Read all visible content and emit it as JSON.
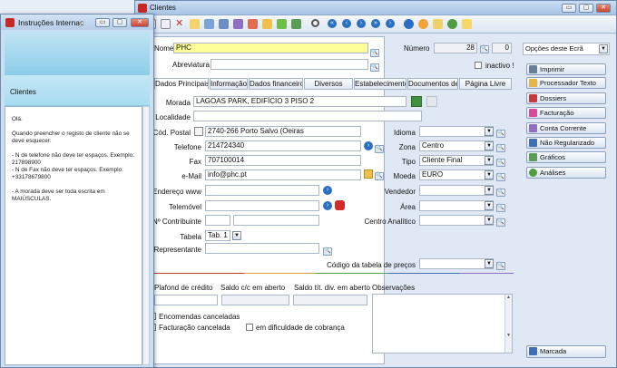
{
  "main_window": {
    "title": "Clientes",
    "controls": {
      "minimize": "▭",
      "maximize": "▢",
      "close": "✕"
    }
  },
  "form": {
    "nome_label": "Nome",
    "nome_value": "PHC",
    "numero_label": "Número",
    "numero_value": "28",
    "numero_extra": "0",
    "abreviatura_label": "Abreviatura",
    "abreviatura_value": "",
    "inactivo_label": "inactivo !",
    "tabs": [
      "Dados Principais",
      "Informação",
      "Dados financeiro",
      "Diversos",
      "Estabelecimento",
      "Documentos de",
      "Página Livre"
    ],
    "morada_label": "Morada",
    "morada_value": "LAGOAS PARK, EDIFÍCIO 3 PISO 2",
    "localidade_label": "Localidade",
    "localidade_value": "",
    "codpostal_label": "Cód. Postal",
    "codpostal_value": "2740-266 Porto Salvo (Oeiras",
    "telefone_label": "Telefone",
    "telefone_value": "214724340",
    "fax_label": "Fax",
    "fax_value": "707100014",
    "email_label": "e-Mail",
    "email_value": "info@phc.pt",
    "endereco_label": "Endereço www",
    "endereco_value": "",
    "telemovel_label": "Telemóvel",
    "telemovel_value": "",
    "contribuinte_label": "Nº Contribuinte",
    "contribuinte_value": "",
    "tabela_label": "Tabela",
    "tabela_value": "Tab. 1",
    "representante_label": "Representante",
    "representante_value": "",
    "idioma_label": "Idioma",
    "idioma_value": "",
    "zona_label": "Zona",
    "zona_value": "Centro",
    "tipo_label": "Tipo",
    "tipo_value": "Cliente Final",
    "moeda_label": "Moeda",
    "moeda_value": "EURO",
    "vendedor_label": "Vendedor",
    "vendedor_value": "",
    "area_label": "Área",
    "area_value": "",
    "ccanalitico_label": "Centro Analítico",
    "ccanalitico_value": "",
    "codtabela_label": "Código da tabela de preços",
    "codtabela_value": "",
    "plafond_label": "Plafond de crédito",
    "saldo_label": "Saldo c/c em aberto",
    "saldotit_label": "Saldo tít. div. em aberto",
    "observacoes_label": "Observações",
    "enc_canceladas_label": "Encomendas canceladas",
    "fact_cancelada_label": "Facturação cancelada",
    "dificuldade_label": "em dificuldade de cobrança"
  },
  "right_panel": {
    "opcoes_label": "Opções deste Ecrã",
    "actions": [
      "Imprimir",
      "Processador Texto",
      "Dossiers",
      "Facturação",
      "Conta Corrente",
      "Não Regularizado",
      "Gráficos",
      "Análises"
    ],
    "marcada_label": "Marcada"
  },
  "popup": {
    "title": "Instruções Internas",
    "section": "Clientes",
    "body": [
      "Olá.",
      "Quando preencher o registo de cliente não se deve esquecer:",
      "- N de telefone não deve ter espaços. Exemplo: 217898900",
      "- N de Fax não deve ter espaços. Exemplo: +33178679800",
      "- A morada deve ser toda escrita em MAIÚSCULAS."
    ]
  },
  "colors": {
    "accent_blue": "#2b6fc2",
    "window_frame": "#6d8bb0",
    "yellow_field": "#ffff99",
    "popup_banner": "#8dcde9"
  }
}
